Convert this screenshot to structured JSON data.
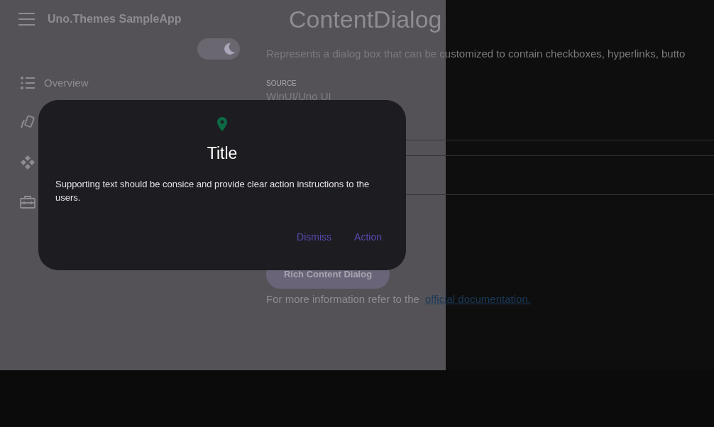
{
  "app": {
    "title": "Uno.Themes SampleApp"
  },
  "theme_toggle": {
    "on": true
  },
  "nav": [
    {
      "kind": "list",
      "label": "Overview"
    },
    {
      "kind": "cards"
    },
    {
      "kind": "shapes"
    },
    {
      "kind": "toolbox"
    }
  ],
  "page": {
    "title": "ContentDialog",
    "description": "Represents a dialog box that can be customized to contain checkboxes, hyperlinks, butto",
    "source_label": "SOURCE",
    "source_value": "WinUI/Uno UI",
    "button": "Rich Content Dialog",
    "info": "For more information refer to the",
    "link": "official documentation."
  },
  "dialog": {
    "title": "Title",
    "text": "Supporting text should be consice and provide clear action instructions to the users.",
    "buttons": [
      "Dismiss",
      "Action"
    ]
  }
}
